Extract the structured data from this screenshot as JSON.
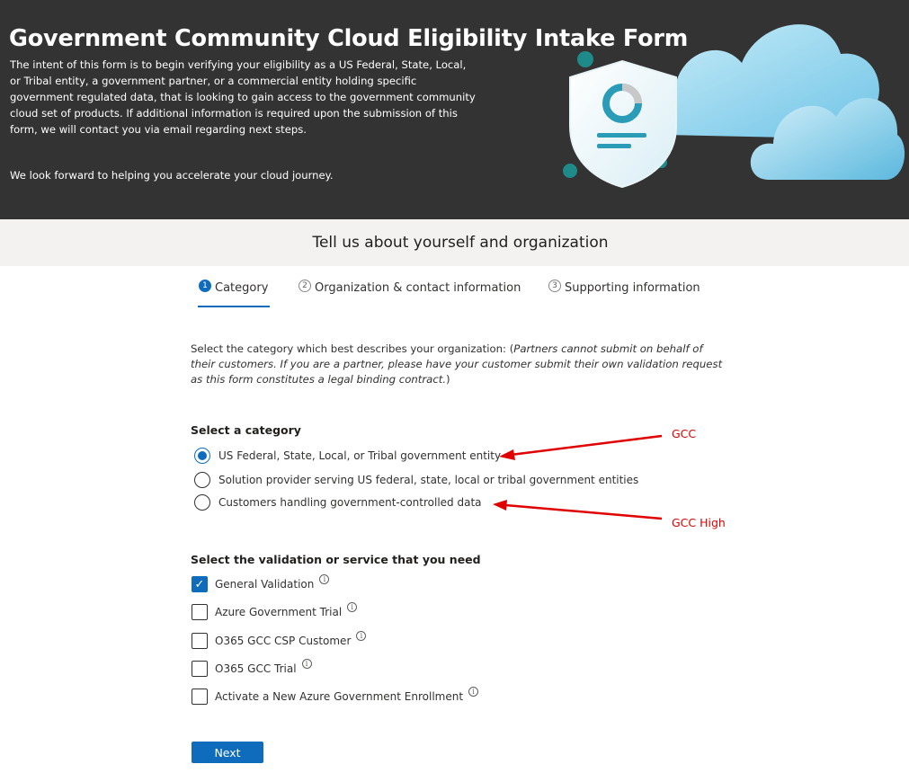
{
  "header": {
    "title": "Government Community Cloud Eligibility Intake Form",
    "intro": "The intent of this form is to begin verifying your eligibility as a US Federal, State, Local, or Tribal entity, a government partner, or a commercial entity holding specific government regulated data, that is looking to gain access to the government community cloud set of products. If additional information is required upon the submission of this form, we will contact you via email regarding next steps.",
    "outro": "We look forward to helping you accelerate your cloud journey."
  },
  "section_title": "Tell us about yourself and organization",
  "steps": [
    {
      "number": "1",
      "label": "Category",
      "active": true
    },
    {
      "number": "2",
      "label": "Organization & contact information",
      "active": false
    },
    {
      "number": "3",
      "label": "Supporting information",
      "active": false
    }
  ],
  "instructions": {
    "lead": "Select the category which best describes your organization: (",
    "note": "Partners cannot submit on behalf of their customers. If you are a partner, please have your customer submit their own validation request as this form constitutes a legal binding contract.",
    "tail": ")"
  },
  "category": {
    "label": "Select a category",
    "options": [
      {
        "label": "US Federal, State, Local, or Tribal government entity",
        "selected": true
      },
      {
        "label": "Solution provider serving US federal, state, local or tribal government entities",
        "selected": false
      },
      {
        "label": "Customers handling government-controlled data",
        "selected": false
      }
    ]
  },
  "services": {
    "label": "Select the validation or service that you need",
    "options": [
      {
        "label": "General Validation",
        "checked": true
      },
      {
        "label": "Azure Government Trial",
        "checked": false
      },
      {
        "label": "O365 GCC CSP Customer",
        "checked": false
      },
      {
        "label": "O365 GCC Trial",
        "checked": false
      },
      {
        "label": "Activate a New Azure Government Enrollment",
        "checked": false
      }
    ],
    "info_glyph": "i"
  },
  "next_label": "Next",
  "annotations": {
    "gcc": "GCC",
    "gcc_high": "GCC High",
    "color": "#e00000"
  },
  "icons": {
    "shield": "shield-icon",
    "cloud": "cloud-icon",
    "check": "✓"
  },
  "colors": {
    "header_bg": "#333333",
    "accent": "#0f6cbd",
    "band_bg": "#f3f2f1"
  }
}
